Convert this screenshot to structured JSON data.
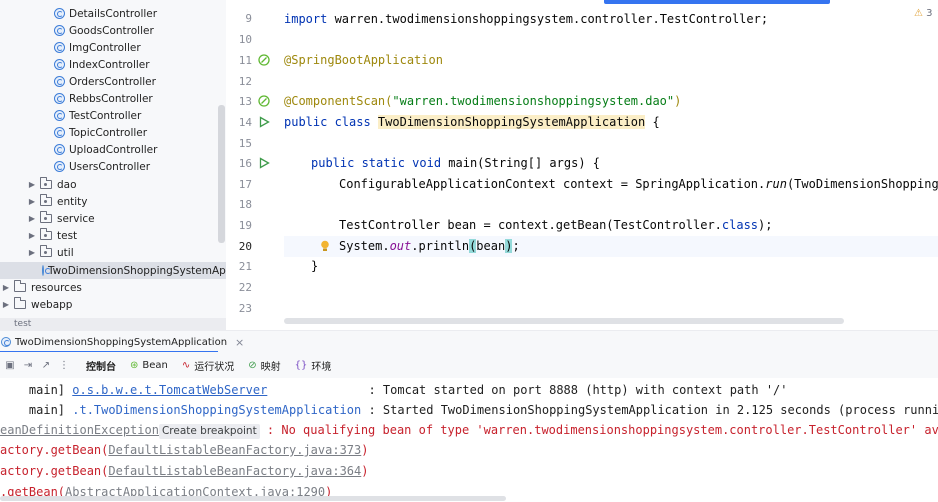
{
  "project_tree": {
    "controllers": [
      "DetailsController",
      "GoodsController",
      "ImgController",
      "IndexController",
      "OrdersController",
      "RebbsController",
      "TestController",
      "TopicController",
      "UploadController",
      "UsersController"
    ],
    "packages": [
      "dao",
      "entity",
      "service",
      "test",
      "util"
    ],
    "main_class": "TwoDimensionShoppingSystemApplicat",
    "folders": [
      "resources",
      "webapp"
    ],
    "bottom_folder": "test"
  },
  "editor": {
    "warning_count": "3",
    "line_numbers": [
      "9",
      "10",
      "11",
      "12",
      "13",
      "14",
      "15",
      "16",
      "17",
      "18",
      "19",
      "20",
      "21",
      "22",
      "23"
    ],
    "current_line": "20",
    "code": {
      "l9_kw": "import",
      "l9_rest": " warren.twodimensionshoppingsystem.controller.TestController;",
      "l11_ann": "@SpringBootApplication",
      "l13_ann": "@ComponentScan(",
      "l13_str": "\"warren.twodimensionshoppingsystem.dao\"",
      "l13_close": ")",
      "l14_kw": "public class ",
      "l14_name": "TwoDimensionShoppingSystemApplication",
      "l14_brace": " {",
      "l16_kw": "public static void ",
      "l16_rest": "main(String[] args) {",
      "l17_a": "ConfigurableApplicationContext context = SpringApplication.",
      "l17_run": "run",
      "l17_b": "(TwoDimensionShoppingSyste",
      "l19_a": "TestController bean = context.getBean(TestController.",
      "l19_kw": "class",
      "l19_b": ");",
      "l20_a": "System.",
      "l20_out": "out",
      "l20_b": ".println",
      "l20_p1": "(",
      "l20_bean": "bean",
      "l20_p2": ")",
      "l20_c": ";",
      "l21": "}"
    }
  },
  "divider_label": "test",
  "run_panel": {
    "tab_title": "TwoDimensionShoppingSystemApplication",
    "tab_close": "×",
    "toolbar_tabs": [
      {
        "glyph": "",
        "label": "控制台"
      },
      {
        "glyph": "⊛",
        "label": "Bean"
      },
      {
        "glyph": "∿",
        "label": "运行状况"
      },
      {
        "glyph": "⊘",
        "label": "映射"
      },
      {
        "glyph": "{}",
        "label": "环境"
      }
    ],
    "console": {
      "l1_thread": "    main] ",
      "l1_logger": "o.s.b.w.e.t.TomcatWebServer",
      "l1_pad": "             ",
      "l1_msg": " : Tomcat started on port 8888 (http) with context path '/'",
      "l2_thread": "    main] ",
      "l2_logger": ".t.TwoDimensionShoppingSystemApplication",
      "l2_msg": " : Started TwoDimensionShoppingSystemApplication in 2.125 seconds (process running for",
      "l3_exc": "eanDefinitionException",
      "l3_chip": "Create breakpoint",
      "l3_msg": " : No qualifying bean of type 'warren.twodimensionshoppingsystem.controller.TestController' available",
      "l4_pre": "actory.getBean(",
      "l4_link": "DefaultListableBeanFactory.java:373",
      "l4_post": ")",
      "l5_pre": "actory.getBean(",
      "l5_link": "DefaultListableBeanFactory.java:364",
      "l5_post": ")",
      "l6_pre": ".getBean(",
      "l6_link": "AbstractApplicationContext.java:1290",
      "l6_post": ")"
    }
  }
}
